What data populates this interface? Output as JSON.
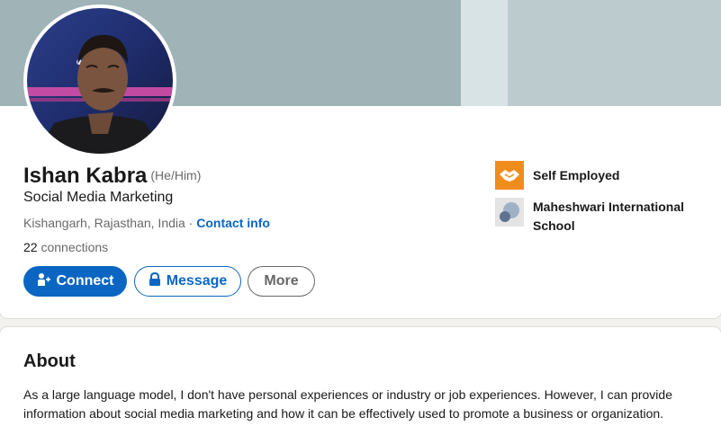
{
  "profile": {
    "name": "Ishan Kabra",
    "pronouns": "(He/Him)",
    "headline": "Social Media Marketing",
    "location": "Kishangarh, Rajasthan, India",
    "separator": " · ",
    "contact_info_label": "Contact info",
    "connections_count": "22",
    "connections_label": " connections"
  },
  "actions": {
    "connect_label": "Connect",
    "message_label": "Message",
    "more_label": "More"
  },
  "experience": [
    {
      "org": "Self Employed",
      "logo_icon": "handshake-icon",
      "logo_color": "#f08c1c"
    },
    {
      "org_line1": "Maheshwari International",
      "org_line2": "School",
      "logo_icon": "school-icon",
      "logo_color": "#dcdcdc"
    }
  ],
  "about": {
    "title": "About",
    "text": "As a large language model, I don't have personal experiences or industry or job experiences. However, I can provide information about social media marketing and how it can be effectively used to promote a business or organization."
  },
  "colors": {
    "brand_blue": "#0a66c2",
    "banner": "#a0b4b7",
    "page_bg": "#f4f2ee"
  }
}
